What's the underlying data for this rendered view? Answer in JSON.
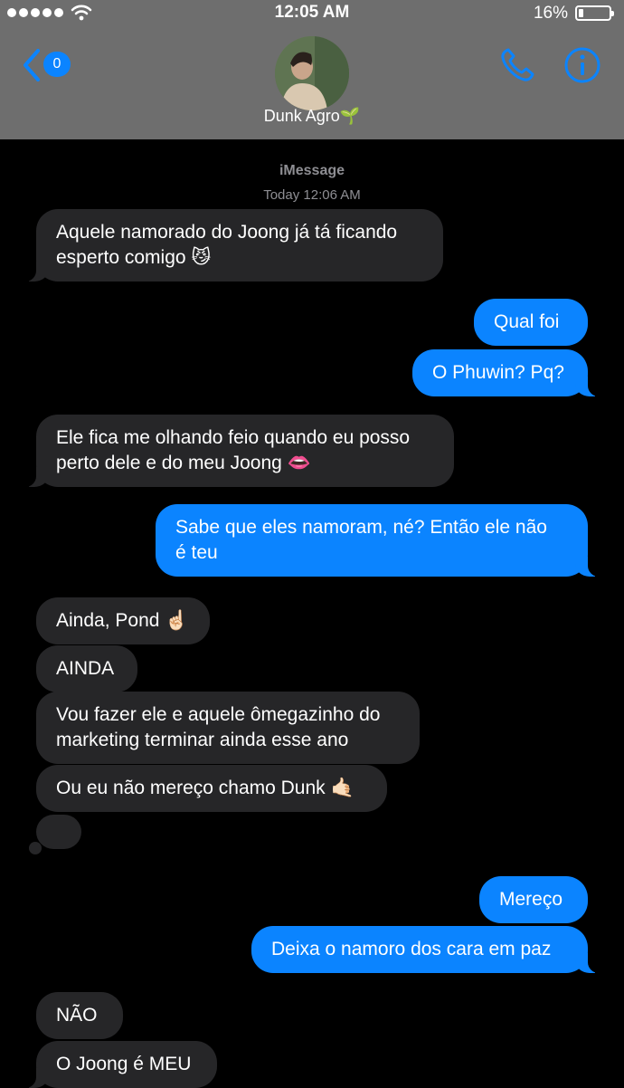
{
  "status_bar": {
    "time": "12:05 AM",
    "battery": "16%",
    "battery_level": 0.16,
    "signal_dots": 5
  },
  "header": {
    "back_count": "0",
    "contact_name": "Dunk Agro🌱",
    "icons": [
      "back-chevron-icon",
      "phone-icon",
      "info-icon"
    ]
  },
  "conversation": {
    "service": "iMessage",
    "timestamp": "Today 12:06 AM",
    "messages": [
      {
        "from": "them",
        "text": "Aquele namorado do Joong já tá ficando\nesperto comigo 😼"
      },
      {
        "from": "me",
        "text": "Qual foi"
      },
      {
        "from": "me",
        "text": "O Phuwin? Pq?"
      },
      {
        "from": "them",
        "text": "Ele fica me olhando feio quando eu posso\nperto dele e do meu Joong 👄"
      },
      {
        "from": "me",
        "text": "Sabe que eles namoram, né? Então ele não\né teu"
      },
      {
        "from": "them",
        "text": "Ainda, Pond ☝🏻"
      },
      {
        "from": "them",
        "text": "AINDA"
      },
      {
        "from": "them",
        "text": "Vou fazer ele e aquele ômegazinho do\nmarketing terminar ainda esse ano"
      },
      {
        "from": "them",
        "text": "Ou eu não mereço chamo Dunk 🤙🏻"
      },
      {
        "from": "me",
        "text": "Mereço"
      },
      {
        "from": "me",
        "text": "Deixa o namoro dos cara em paz"
      },
      {
        "from": "them",
        "text": "NÃO"
      },
      {
        "from": "them",
        "text": "O Joong é MEU"
      }
    ]
  },
  "colors": {
    "bar_background": "#6e6e6e",
    "incoming_bubble": "#262628",
    "outgoing_bubble": "#0b84ff",
    "accent": "#0b84ff"
  }
}
